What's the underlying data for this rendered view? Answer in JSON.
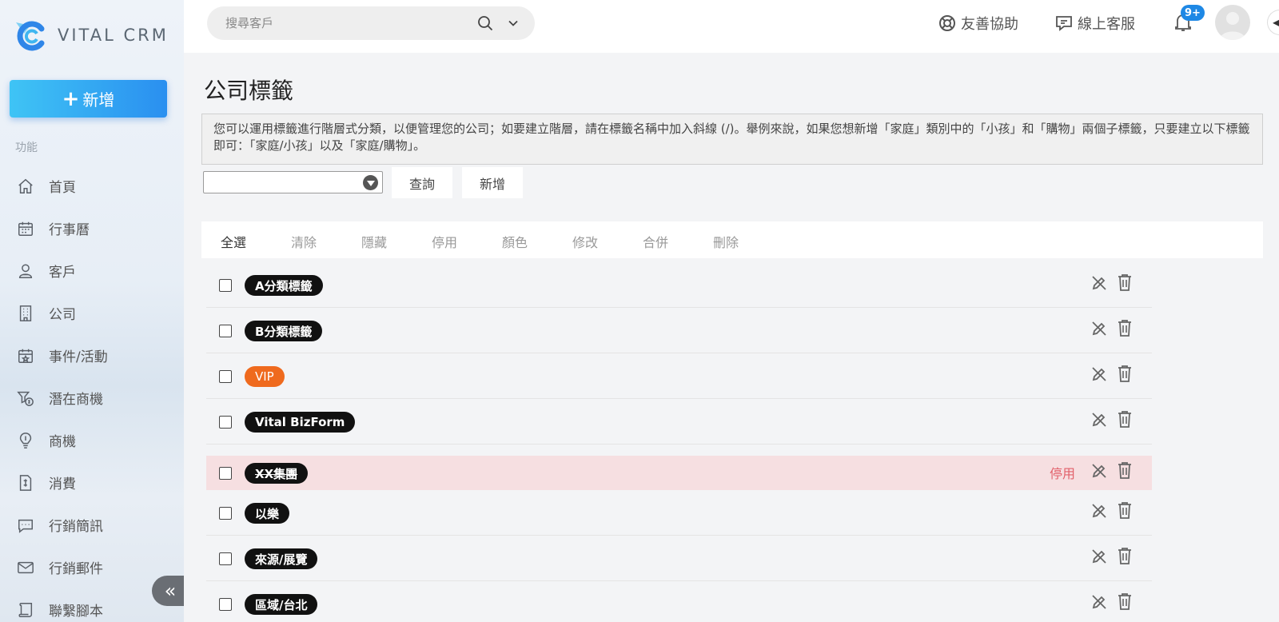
{
  "app": {
    "brand": "VITAL CRM"
  },
  "sidebar": {
    "add_label": "新增",
    "section_label": "功能",
    "items": [
      {
        "label": "首頁",
        "icon": "home-icon"
      },
      {
        "label": "行事曆",
        "icon": "calendar-icon"
      },
      {
        "label": "客戶",
        "icon": "customer-icon"
      },
      {
        "label": "公司",
        "icon": "building-icon"
      },
      {
        "label": "事件/活動",
        "icon": "event-icon"
      },
      {
        "label": "潛在商機",
        "icon": "lead-icon"
      },
      {
        "label": "商機",
        "icon": "opportunity-icon"
      },
      {
        "label": "消費",
        "icon": "receipt-icon"
      },
      {
        "label": "行銷簡訊",
        "icon": "sms-icon"
      },
      {
        "label": "行銷郵件",
        "icon": "mail-icon"
      },
      {
        "label": "聯繫腳本",
        "icon": "script-icon"
      }
    ]
  },
  "header": {
    "search_placeholder": "搜尋客戶",
    "help_label": "友善協助",
    "support_label": "線上客服",
    "notification_badge": "9+"
  },
  "main": {
    "title": "公司標籤",
    "description": "您可以運用標籤進行階層式分類，以便管理您的公司；如要建立階層，請在標籤名稱中加入斜線 (/)。舉例來說，如果您想新增「家庭」類別中的「小孩」和「購物」兩個子標籤，只要建立以下標籤即可：「家庭/小孩」以及「家庭/購物」。",
    "filter_value": "",
    "query_label": "查詢",
    "add_label": "新增",
    "actions": [
      "全選",
      "清除",
      "隱藏",
      "停用",
      "顏色",
      "修改",
      "合併",
      "刪除"
    ],
    "tags": [
      {
        "name": "A分類標籤",
        "color": "#111111",
        "disabled": false,
        "status": ""
      },
      {
        "name": "B分類標籤",
        "color": "#111111",
        "disabled": false,
        "status": ""
      },
      {
        "name": "VIP",
        "color": "#ef6a1e",
        "disabled": false,
        "status": ""
      },
      {
        "name": "Vital BizForm",
        "color": "#111111",
        "disabled": false,
        "status": ""
      },
      {
        "name": "XX集團",
        "color": "#111111",
        "disabled": true,
        "status": "停用"
      },
      {
        "name": "以樂",
        "color": "#111111",
        "disabled": false,
        "status": ""
      },
      {
        "name": "來源/展覽",
        "color": "#111111",
        "disabled": false,
        "status": ""
      },
      {
        "name": "區域/台北",
        "color": "#111111",
        "disabled": false,
        "status": ""
      }
    ]
  }
}
